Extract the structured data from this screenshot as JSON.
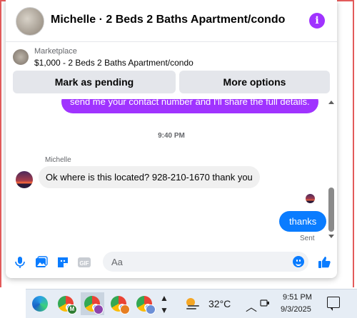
{
  "header": {
    "title": "Michelle · 2 Beds 2 Baths Apartment/condo",
    "info_icon": "info-icon",
    "info_glyph": "i"
  },
  "marketplace": {
    "label": "Marketplace",
    "listing": "$1,000 - 2 Beds 2 Baths Apartment/condo",
    "pending_button": "Mark as pending",
    "options_button": "More options"
  },
  "conversation": {
    "outgoing_partial": "send me your contact number and I'll share the full details.",
    "timestamp": "9:40 PM",
    "sender_name": "Michelle",
    "incoming_message": "Ok where is this located? 928-210-1670 thank you",
    "sent_message": "thanks",
    "sent_status": "Sent"
  },
  "composer": {
    "placeholder": "Aa",
    "icons": [
      "microphone-icon",
      "photo-icon",
      "sticker-icon",
      "gif-icon",
      "emoji-icon",
      "like-icon"
    ],
    "gif_label": "GIF"
  },
  "taskbar": {
    "apps": [
      "edge-icon",
      "chrome-icon",
      "chrome-icon",
      "chrome-icon",
      "chrome-icon"
    ],
    "badges": [
      "M",
      "",
      "",
      ""
    ],
    "temperature": "32°C",
    "time": "9:51 PM",
    "date": "9/3/2025"
  },
  "colors": {
    "accent_purple": "#a033ff",
    "messenger_blue": "#0a7cff",
    "bubble_gray": "#f0f0f0"
  }
}
